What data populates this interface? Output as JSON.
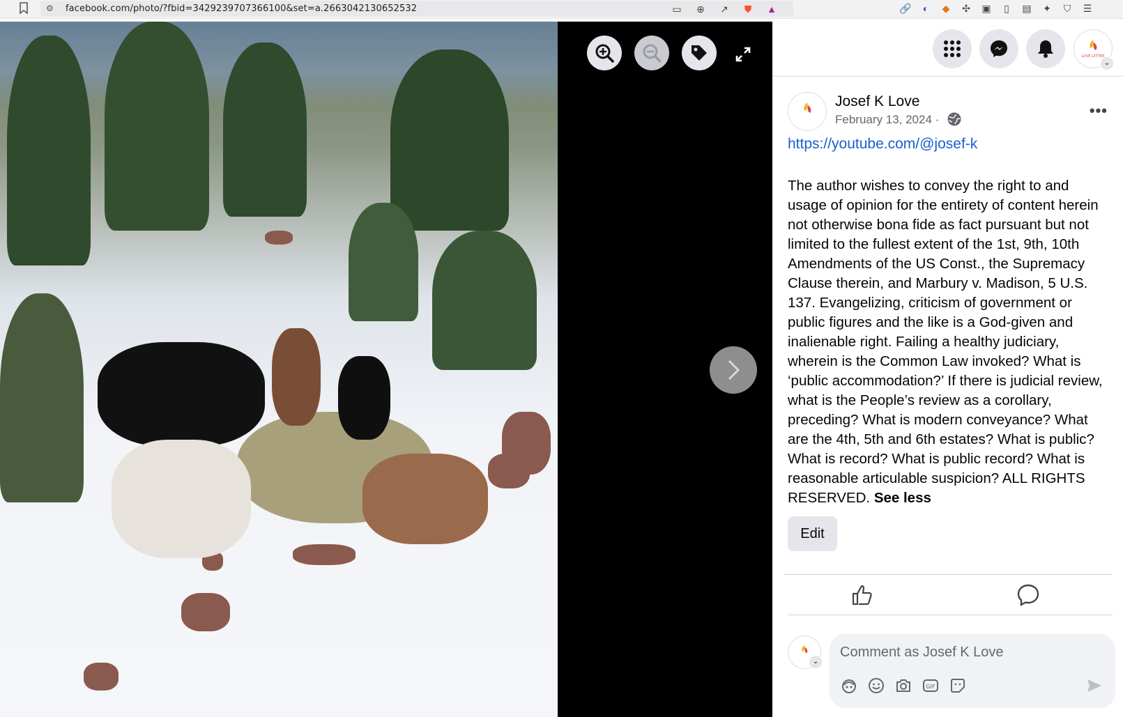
{
  "browser": {
    "url": "facebook.com/photo/?fbid=3429239707366100&set=a.2663042130652532",
    "tune_icon": "site-settings-icon",
    "icons": [
      "install-app-icon",
      "zoom-icon",
      "share-icon",
      "brave-shield-icon",
      "brave-rewards-icon"
    ],
    "extension_icons": [
      "link-icon",
      "extension-a-icon",
      "metamask-icon",
      "puzzle-icon",
      "window-icon",
      "sidebar-icon",
      "wallet-icon",
      "leo-icon",
      "vpn-icon",
      "menu-icon"
    ]
  },
  "viewer": {
    "image_subject": "goats eating hay in snow",
    "controls": [
      "zoom-in",
      "zoom-out",
      "tag",
      "fullscreen"
    ],
    "next_label": "Next photo"
  },
  "topnav": {
    "menu_icon": "apps-grid-icon",
    "messenger_icon": "messenger-icon",
    "notifications_icon": "bell-icon",
    "profile_badge": "LOVE LETTER"
  },
  "post": {
    "author": "Josef K Love",
    "date": "February 13, 2024",
    "date_sep": " · ",
    "privacy_icon": "globe-icon",
    "more_label": "•••",
    "link": "https://youtube.com/@josef-k",
    "body": "The author wishes to convey the right to and usage of opinion for the entirety of content herein not otherwise bona fide as fact pursuant but not limited to the fullest extent of the 1st, 9th, 10th Amendments of the US Const., the Supremacy Clause therein, and Marbury v. Madison, 5 U.S. 137. Evangelizing, criticism of government or public figures and the like is a God-given and inalienable right. Failing a healthy judiciary, wherein is the Common Law invoked? What is ‘public accommodation?’ If there is judicial review, what is the People’s review as a corollary, preceding? What is modern conveyance? What are the 4th, 5th and 6th estates? What is public? What is record? What is public record? What is reasonable articulable suspicion? ALL RIGHTS RESERVED.",
    "see_less": "See less",
    "edit_label": "Edit",
    "comment_placeholder": "Comment as Josef K Love",
    "comment_tools": [
      "avatar-sticker-icon",
      "emoji-icon",
      "camera-icon",
      "gif-icon",
      "sticker-icon"
    ]
  },
  "colors": {
    "link": "#1a5fce",
    "button_bg": "#e4e6eb",
    "text_secondary": "#65676b"
  }
}
